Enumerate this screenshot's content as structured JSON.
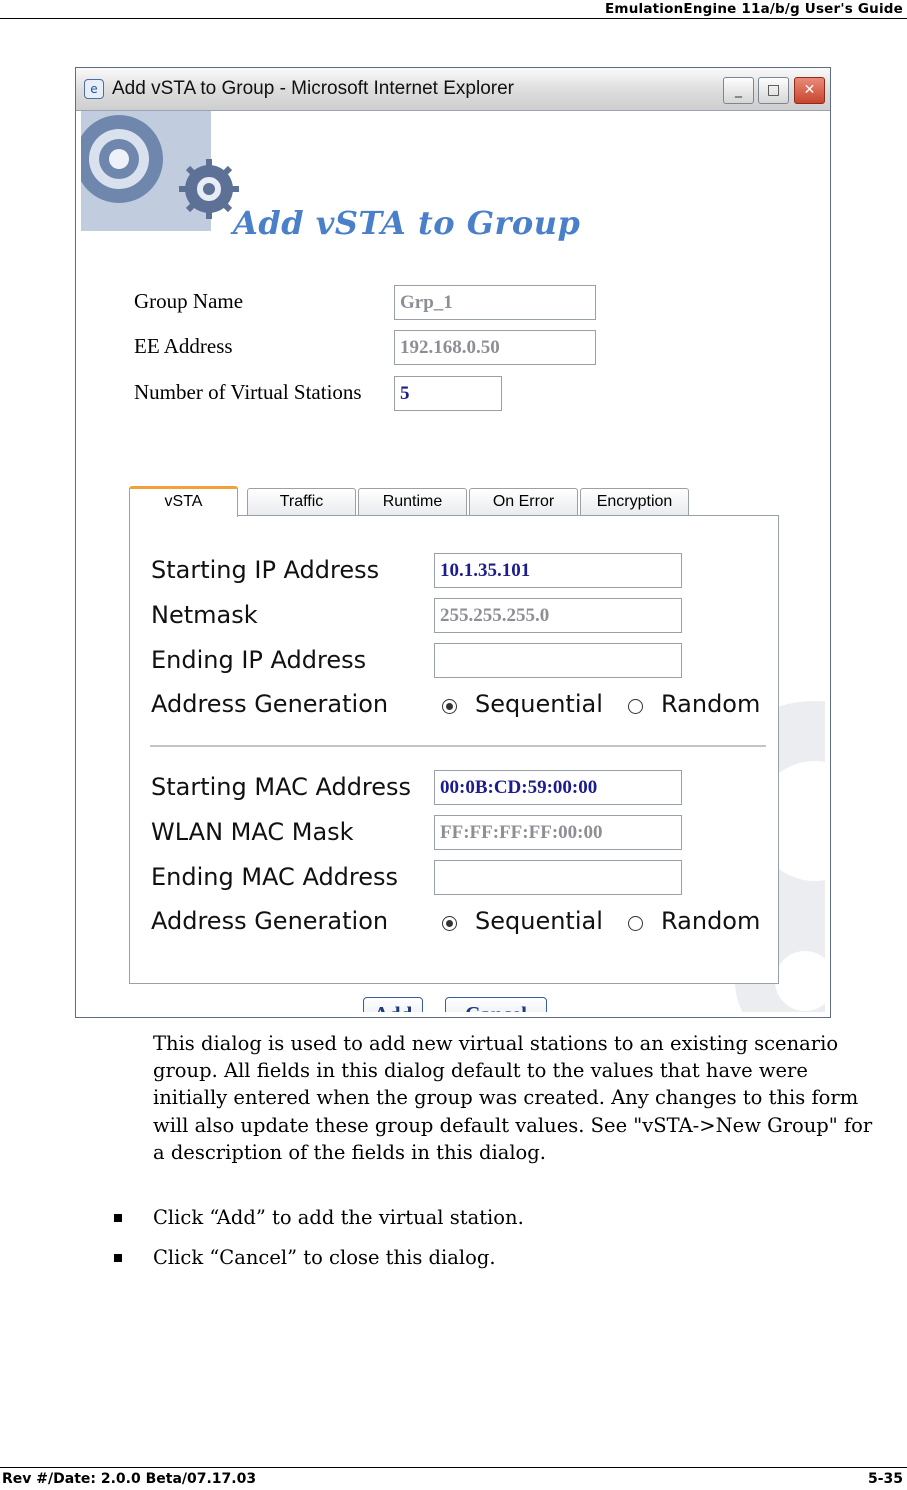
{
  "header": {
    "title": "EmulationEngine 11a/b/g User's Guide"
  },
  "window": {
    "title": "Add vSTA to Group - Microsoft Internet Explorer",
    "controls": {
      "minimize": "_",
      "maximize": "□",
      "close": "✕"
    }
  },
  "form": {
    "heading": "Add vSTA to Group",
    "group_name": {
      "label": "Group Name",
      "value": "Grp_1"
    },
    "ee_address": {
      "label": "EE Address",
      "value": "192.168.0.50"
    },
    "num_stations": {
      "label": "Number of Virtual Stations",
      "value": "5"
    },
    "tabs": [
      {
        "label": "vSTA",
        "active": true
      },
      {
        "label": "Traffic",
        "active": false
      },
      {
        "label": "Runtime",
        "active": false
      },
      {
        "label": "On Error",
        "active": false
      },
      {
        "label": "Encryption",
        "active": false
      }
    ],
    "vsta": {
      "starting_ip": {
        "label": "Starting IP Address",
        "value": "10.1.35.101"
      },
      "netmask": {
        "label": "Netmask",
        "value": "255.255.255.0"
      },
      "ending_ip": {
        "label": "Ending IP Address",
        "value": ""
      },
      "ip_generation": {
        "label": "Address Generation",
        "options": [
          "Sequential",
          "Random"
        ],
        "selected": "Sequential"
      },
      "starting_mac": {
        "label": "Starting MAC Address",
        "value": "00:0B:CD:59:00:00"
      },
      "wlan_mac_mask": {
        "label": "WLAN MAC Mask",
        "value": "FF:FF:FF:FF:00:00"
      },
      "ending_mac": {
        "label": "Ending MAC Address",
        "value": ""
      },
      "mac_generation": {
        "label": "Address Generation",
        "options": [
          "Sequential",
          "Random"
        ],
        "selected": "Sequential"
      }
    },
    "buttons": {
      "add": "Add",
      "cancel": "Cancel"
    }
  },
  "body": {
    "paragraph": "This dialog is used to add new virtual stations to an existing scenario group. All fields in this dialog default to the values that have were initially entered when the group was created. Any changes to this form will also update these group default values. See \"vSTA->New Group\" for a description of the fields in this dialog.",
    "bullets": [
      "Click “Add” to add the virtual station.",
      "Click “Cancel” to close this dialog."
    ]
  },
  "footer": {
    "left": "Rev #/Date: 2.0.0 Beta/07.17.03",
    "right": "5-35"
  }
}
